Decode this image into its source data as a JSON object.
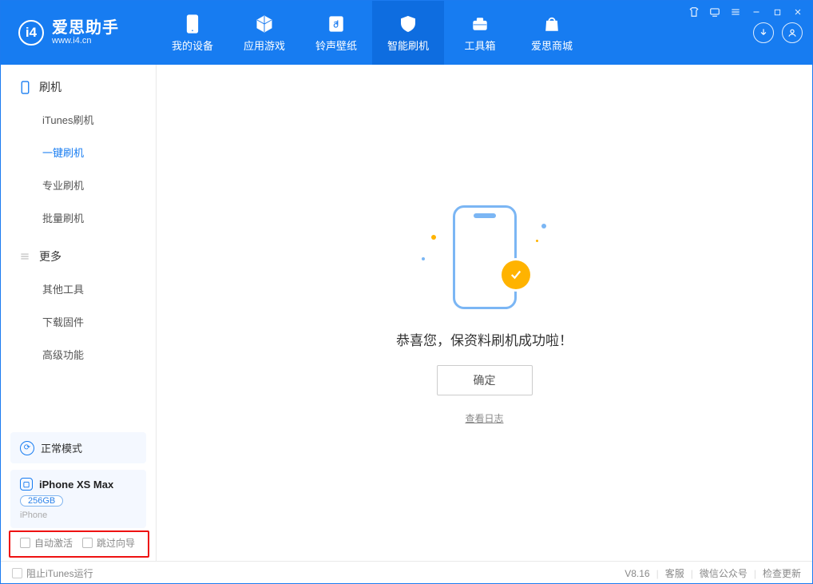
{
  "brand": {
    "name": "爱思助手",
    "url": "www.i4.cn",
    "logo_letter": "i4"
  },
  "header_tabs": [
    {
      "id": "device",
      "label": "我的设备"
    },
    {
      "id": "apps",
      "label": "应用游戏"
    },
    {
      "id": "ring",
      "label": "铃声壁纸"
    },
    {
      "id": "flash",
      "label": "智能刷机"
    },
    {
      "id": "toolbox",
      "label": "工具箱"
    },
    {
      "id": "store",
      "label": "爱思商城"
    }
  ],
  "sidebar": {
    "section_flash": {
      "title": "刷机",
      "items": [
        {
          "id": "itunes",
          "label": "iTunes刷机"
        },
        {
          "id": "onekey",
          "label": "一键刷机"
        },
        {
          "id": "pro",
          "label": "专业刷机"
        },
        {
          "id": "batch",
          "label": "批量刷机"
        }
      ]
    },
    "section_more": {
      "title": "更多",
      "items": [
        {
          "id": "other",
          "label": "其他工具"
        },
        {
          "id": "firmware",
          "label": "下载固件"
        },
        {
          "id": "advanced",
          "label": "高级功能"
        }
      ]
    },
    "mode_label": "正常模式",
    "device": {
      "name": "iPhone XS Max",
      "capacity": "256GB",
      "type": "iPhone"
    },
    "auto_activate": "自动激活",
    "skip_guide": "跳过向导"
  },
  "main": {
    "success_text": "恭喜您，保资料刷机成功啦！",
    "ok_btn": "确定",
    "log_link": "查看日志"
  },
  "footer": {
    "block_itunes": "阻止iTunes运行",
    "version": "V8.16",
    "links": [
      "客服",
      "微信公众号",
      "检查更新"
    ]
  }
}
